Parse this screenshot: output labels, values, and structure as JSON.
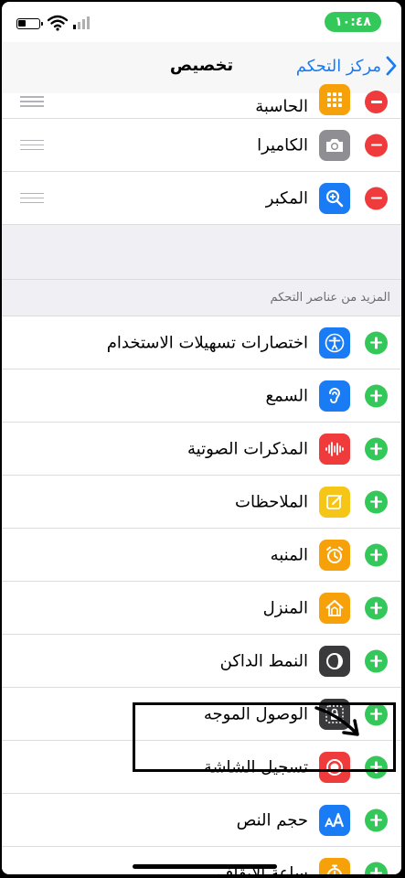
{
  "status_bar": {
    "time": "١٠:٤٨"
  },
  "nav": {
    "title": "تخصيص",
    "back_label": "مركز التحكم"
  },
  "included_controls": [
    {
      "label": "الحاسبة",
      "icon": "calculator-icon",
      "color": "#f7a10a"
    },
    {
      "label": "الكاميرا",
      "icon": "camera-icon",
      "color": "#8e8e93"
    },
    {
      "label": "المكبر",
      "icon": "magnifier-icon",
      "color": "#1a7cf5"
    }
  ],
  "more_section": {
    "header": "المزيد من عناصر التحكم",
    "items": [
      {
        "label": "اختصارات تسهيلات الاستخدام",
        "icon": "accessibility-icon",
        "color": "#1a7cf5"
      },
      {
        "label": "السمع",
        "icon": "ear-icon",
        "color": "#1a7cf5"
      },
      {
        "label": "المذكرات الصوتية",
        "icon": "voice-memo-icon",
        "color": "#ef3b3b"
      },
      {
        "label": "الملاحظات",
        "icon": "notes-icon",
        "color": "#f5c518"
      },
      {
        "label": "المنبه",
        "icon": "alarm-icon",
        "color": "#f7a10a"
      },
      {
        "label": "المنزل",
        "icon": "home-icon",
        "color": "#f7a10a"
      },
      {
        "label": "النمط الداكن",
        "icon": "dark-mode-icon",
        "color": "#3a3a3c"
      },
      {
        "label": "الوصول الموجه",
        "icon": "guided-access-icon",
        "color": "#3a3a3c"
      },
      {
        "label": "تسجيل الشاشة",
        "icon": "screen-record-icon",
        "color": "#ef3b3b"
      },
      {
        "label": "حجم النص",
        "icon": "text-size-icon",
        "color": "#1a7cf5"
      },
      {
        "label": "ساعة الإيقاف",
        "icon": "stopwatch-icon",
        "color": "#f7a10a"
      }
    ]
  },
  "colors": {
    "accent": "#1a7cf5",
    "add": "#34c759",
    "remove": "#ef3b3b"
  }
}
